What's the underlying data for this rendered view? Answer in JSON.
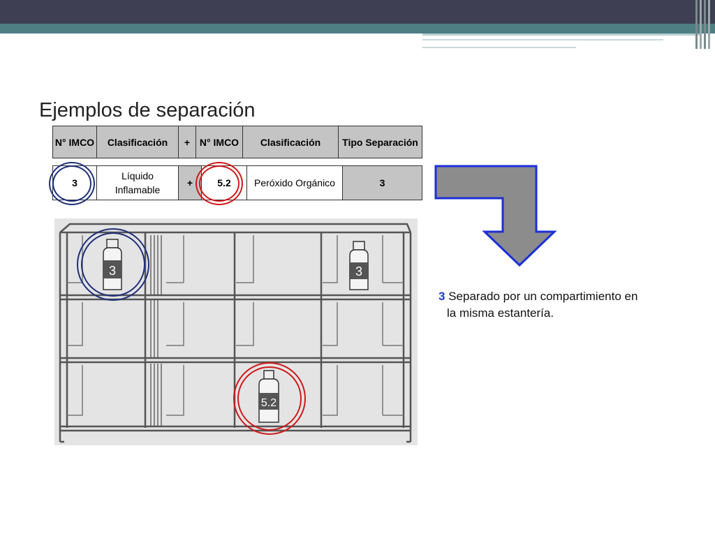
{
  "slide": {
    "title": "Ejemplos de separación"
  },
  "table": {
    "headers": [
      "N° IMCO",
      "Clasificación",
      "+",
      "N° IMCO",
      "Clasificación",
      "Tipo Separación"
    ],
    "row": [
      "3",
      "Líquido Inflamable",
      "+",
      "5.2",
      "Peróxido Orgánico",
      "3"
    ]
  },
  "illustration": {
    "bottle_labels": [
      "3",
      "3",
      "5.2"
    ]
  },
  "note": {
    "number": "3",
    "text_line1": "Separado por un compartimiento en",
    "text_line2": "la misma estantería."
  },
  "colors": {
    "blue_circle": "#1f2f7a",
    "red_circle": "#d01818",
    "arrow_fill": "#8c8c8c",
    "arrow_stroke": "#1b2fd8",
    "header_bg": "#c4c4c4"
  }
}
